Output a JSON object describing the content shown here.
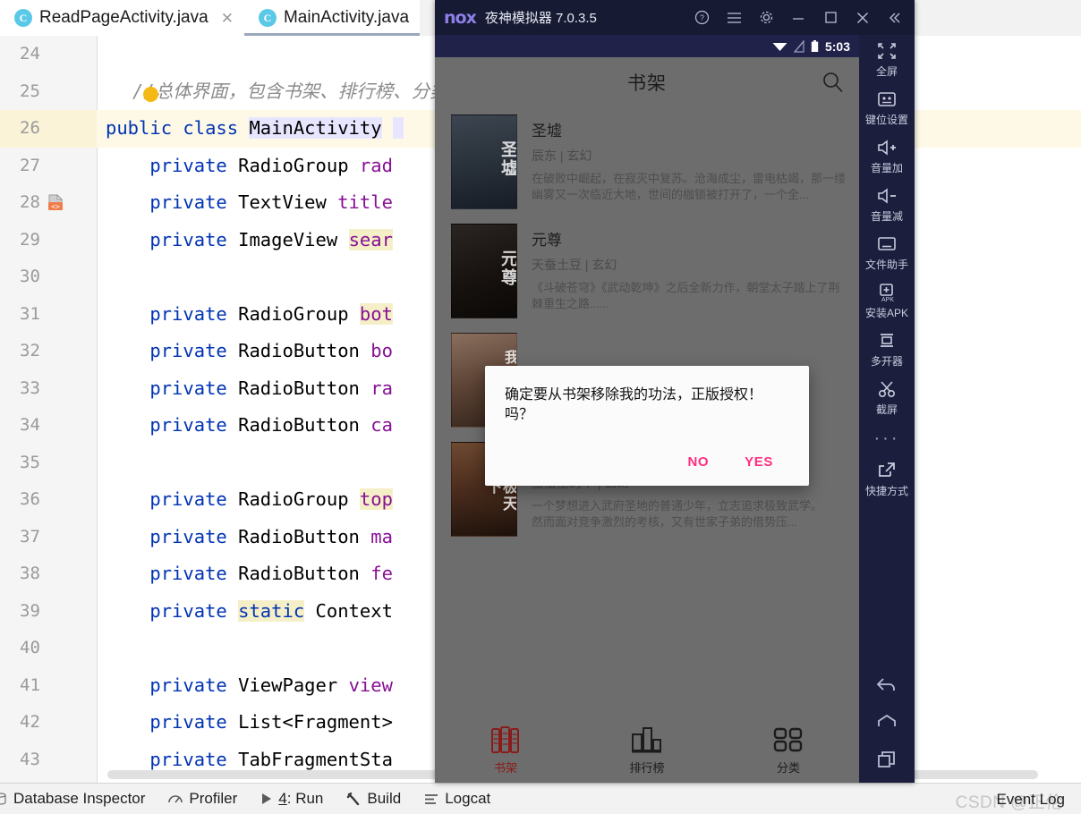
{
  "ide": {
    "tabs": [
      {
        "label": "ReadPageActivity.java",
        "icon": "java-class-icon",
        "closable": true,
        "active": false
      },
      {
        "label": "MainActivity.java",
        "icon": "java-class-icon",
        "closable": false,
        "active": true
      }
    ],
    "code_lines": [
      {
        "num": "24",
        "text": "",
        "kind": "blank"
      },
      {
        "num": "25",
        "text": "//总体界面，包含书架、排行榜、分类",
        "kind": "comment"
      },
      {
        "num": "26",
        "text": "public class MainActivity",
        "kind": "class-decl",
        "highlighted": true,
        "gutter_icon": "java-class-gutter-icon"
      },
      {
        "num": "27",
        "text": "private RadioGroup rad",
        "kind": "field"
      },
      {
        "num": "28",
        "text": "private TextView title",
        "kind": "field"
      },
      {
        "num": "29",
        "text": "private ImageView sear",
        "kind": "field"
      },
      {
        "num": "30",
        "text": "",
        "kind": "blank"
      },
      {
        "num": "31",
        "text": "private RadioGroup bot",
        "kind": "field"
      },
      {
        "num": "32",
        "text": "private RadioButton bo",
        "kind": "field"
      },
      {
        "num": "33",
        "text": "private RadioButton ra",
        "kind": "field"
      },
      {
        "num": "34",
        "text": "private RadioButton ca",
        "kind": "field"
      },
      {
        "num": "35",
        "text": "",
        "kind": "blank"
      },
      {
        "num": "36",
        "text": "private RadioGroup top",
        "kind": "field"
      },
      {
        "num": "37",
        "text": "private RadioButton ma",
        "kind": "field"
      },
      {
        "num": "38",
        "text": "private RadioButton fe",
        "kind": "field"
      },
      {
        "num": "39",
        "text": "private static Context",
        "kind": "field"
      },
      {
        "num": "40",
        "text": "",
        "kind": "blank"
      },
      {
        "num": "41",
        "text": "private ViewPager view",
        "kind": "field"
      },
      {
        "num": "42",
        "text": "private List<Fragment>",
        "kind": "field"
      },
      {
        "num": "43",
        "text": "private TabFragmentSta",
        "kind": "field"
      }
    ],
    "statusbar": {
      "items": [
        {
          "label": "Database Inspector",
          "icon": "database-icon"
        },
        {
          "label": "Profiler",
          "icon": "profiler-icon"
        },
        {
          "label": "4: Run",
          "icon": "run-icon"
        },
        {
          "label": "Build",
          "icon": "build-hammer-icon"
        },
        {
          "label": "Logcat",
          "icon": "logcat-icon"
        }
      ],
      "event_log": "Event Log",
      "watermark": "CSDN @正伦"
    }
  },
  "nox": {
    "titlebar": {
      "logo": "nox",
      "app_name": "夜神模拟器 7.0.3.5",
      "controls": [
        {
          "name": "help-icon",
          "glyph": "?"
        },
        {
          "name": "menu-icon",
          "glyph": "☰"
        },
        {
          "name": "settings-gear-icon",
          "glyph": "⚙"
        },
        {
          "name": "minimize-icon",
          "glyph": "–"
        },
        {
          "name": "maximize-icon",
          "glyph": "□"
        },
        {
          "name": "close-icon",
          "glyph": "✕"
        },
        {
          "name": "collapse-icon",
          "glyph": "«"
        }
      ]
    },
    "sidebar": [
      {
        "label": "全屏",
        "icon": "fullscreen-icon"
      },
      {
        "label": "键位设置",
        "icon": "keymapping-icon"
      },
      {
        "label": "音量加",
        "icon": "volume-up-icon"
      },
      {
        "label": "音量减",
        "icon": "volume-down-icon"
      },
      {
        "label": "文件助手",
        "icon": "file-assistant-icon"
      },
      {
        "label": "安装APK",
        "icon": "install-apk-icon"
      },
      {
        "label": "多开器",
        "icon": "multi-instance-icon"
      },
      {
        "label": "截屏",
        "icon": "screenshot-scissors-icon"
      }
    ],
    "sidebar_more": "···",
    "sidebar_shortcut": {
      "label": "快捷方式",
      "icon": "shortcut-icon"
    },
    "sidebar_nav": [
      {
        "name": "back-icon",
        "label": "back"
      },
      {
        "name": "home-icon",
        "label": "home"
      },
      {
        "name": "recents-icon",
        "label": "recents"
      }
    ]
  },
  "android": {
    "statusbar": {
      "time": "5:03",
      "icons": [
        "wifi-icon",
        "signal-off-icon",
        "battery-icon"
      ]
    },
    "appbar": {
      "title": "书架",
      "search_icon": "search-icon"
    },
    "books": [
      {
        "title": "圣墟",
        "author": "辰东",
        "genre": "玄幻",
        "meta": "辰东  |  玄幻",
        "desc": "在破败中崛起，在寂灭中复苏。沧海成尘，雷电枯竭，那一缕幽雾又一次临近大地，世间的枷锁被打开了，一个全...",
        "cover_text": "圣墟"
      },
      {
        "title": "元尊",
        "author": "天蚕土豆",
        "genre": "玄幻",
        "meta": "天蚕土豆  |  玄幻",
        "desc": "《斗破苍穹》《武动乾坤》之后全新力作，朝堂太子踏上了荆棘重生之路......",
        "cover_text": "元尊"
      },
      {
        "title": "我的功法，正版授权！",
        "author": "",
        "genre": "",
        "meta": "",
        "desc": "",
        "cover_text": "我的正版"
      },
      {
        "title": "武极天下",
        "author": "蚕茧里的牛",
        "genre": "玄幻",
        "meta": "蚕茧里的牛  |  玄幻",
        "desc": "一个梦想进入武府圣地的普通少年，立志追求极致武学。　　然而面对竞争激烈的考核，又有世家子弟的借势压...",
        "cover_text": "武极天下"
      }
    ],
    "dialog": {
      "message": "确定要从书架移除我的功法，正版授权！吗？",
      "no_label": "NO",
      "yes_label": "YES"
    },
    "bottomnav": [
      {
        "label": "书架",
        "icon": "bookshelf-icon",
        "active": true
      },
      {
        "label": "排行榜",
        "icon": "ranking-chart-icon",
        "active": false
      },
      {
        "label": "分类",
        "icon": "category-grid-icon",
        "active": false
      }
    ]
  },
  "colors": {
    "nox_header": "#161a33",
    "nox_sidebar": "#1b1e3d",
    "android_status": "#20224a",
    "dialog_accent": "#ff2e7e",
    "nav_active": "#8b1b1b"
  }
}
